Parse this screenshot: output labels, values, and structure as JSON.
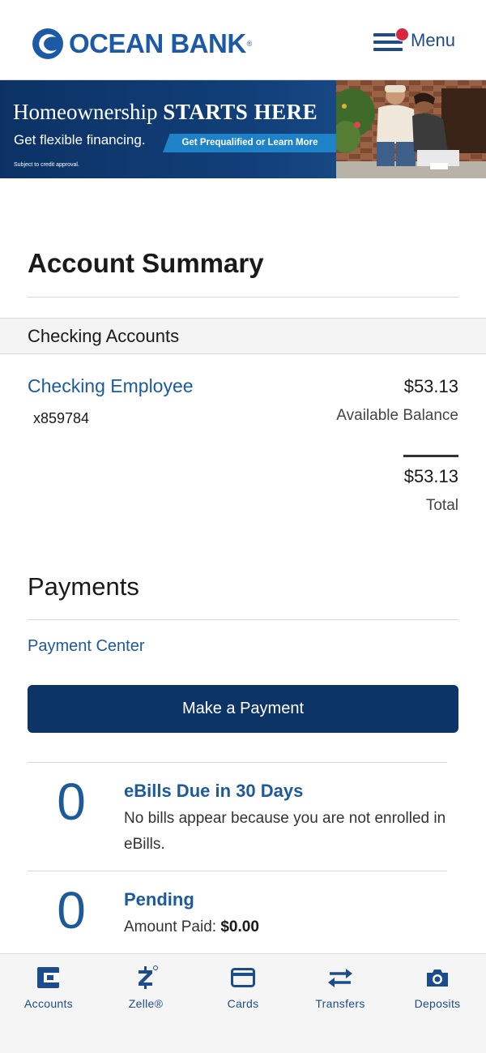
{
  "header": {
    "logo_text": "OCEAN BANK",
    "logo_reg": "®",
    "menu_label": "Menu"
  },
  "banner": {
    "title_regular": "Homeownership",
    "title_bold": "STARTS HERE",
    "subtitle": "Get flexible financing.",
    "cta": "Get Prequalified or Learn More",
    "fine_print": "Subject to credit approval."
  },
  "account_summary": {
    "title": "Account Summary",
    "section_label": "Checking Accounts",
    "accounts": [
      {
        "name": "Checking Employee",
        "number": "x859784",
        "balance": "$53.13",
        "balance_label": "Available Balance"
      }
    ],
    "total": "$53.13",
    "total_label": "Total"
  },
  "payments": {
    "title": "Payments",
    "center_link": "Payment Center",
    "make_payment_label": "Make a Payment",
    "stats": [
      {
        "count": "0",
        "title": "eBills Due in 30 Days",
        "description": "No bills appear because you are not enrolled in eBills."
      },
      {
        "count": "0",
        "title": "Pending",
        "description_prefix": "Amount Paid: ",
        "description_value": "$0.00"
      }
    ]
  },
  "bottom_nav": {
    "items": [
      {
        "label": "Accounts",
        "icon": "wallet-icon"
      },
      {
        "label": "Zelle®",
        "icon": "zelle-icon"
      },
      {
        "label": "Cards",
        "icon": "card-icon"
      },
      {
        "label": "Transfers",
        "icon": "transfer-arrows-icon"
      },
      {
        "label": "Deposits",
        "icon": "camera-icon"
      }
    ]
  },
  "colors": {
    "brand_blue": "#1d5aa5",
    "navy": "#0c3466",
    "link_blue": "#1d5a9a",
    "notification_red": "#d7263d"
  }
}
